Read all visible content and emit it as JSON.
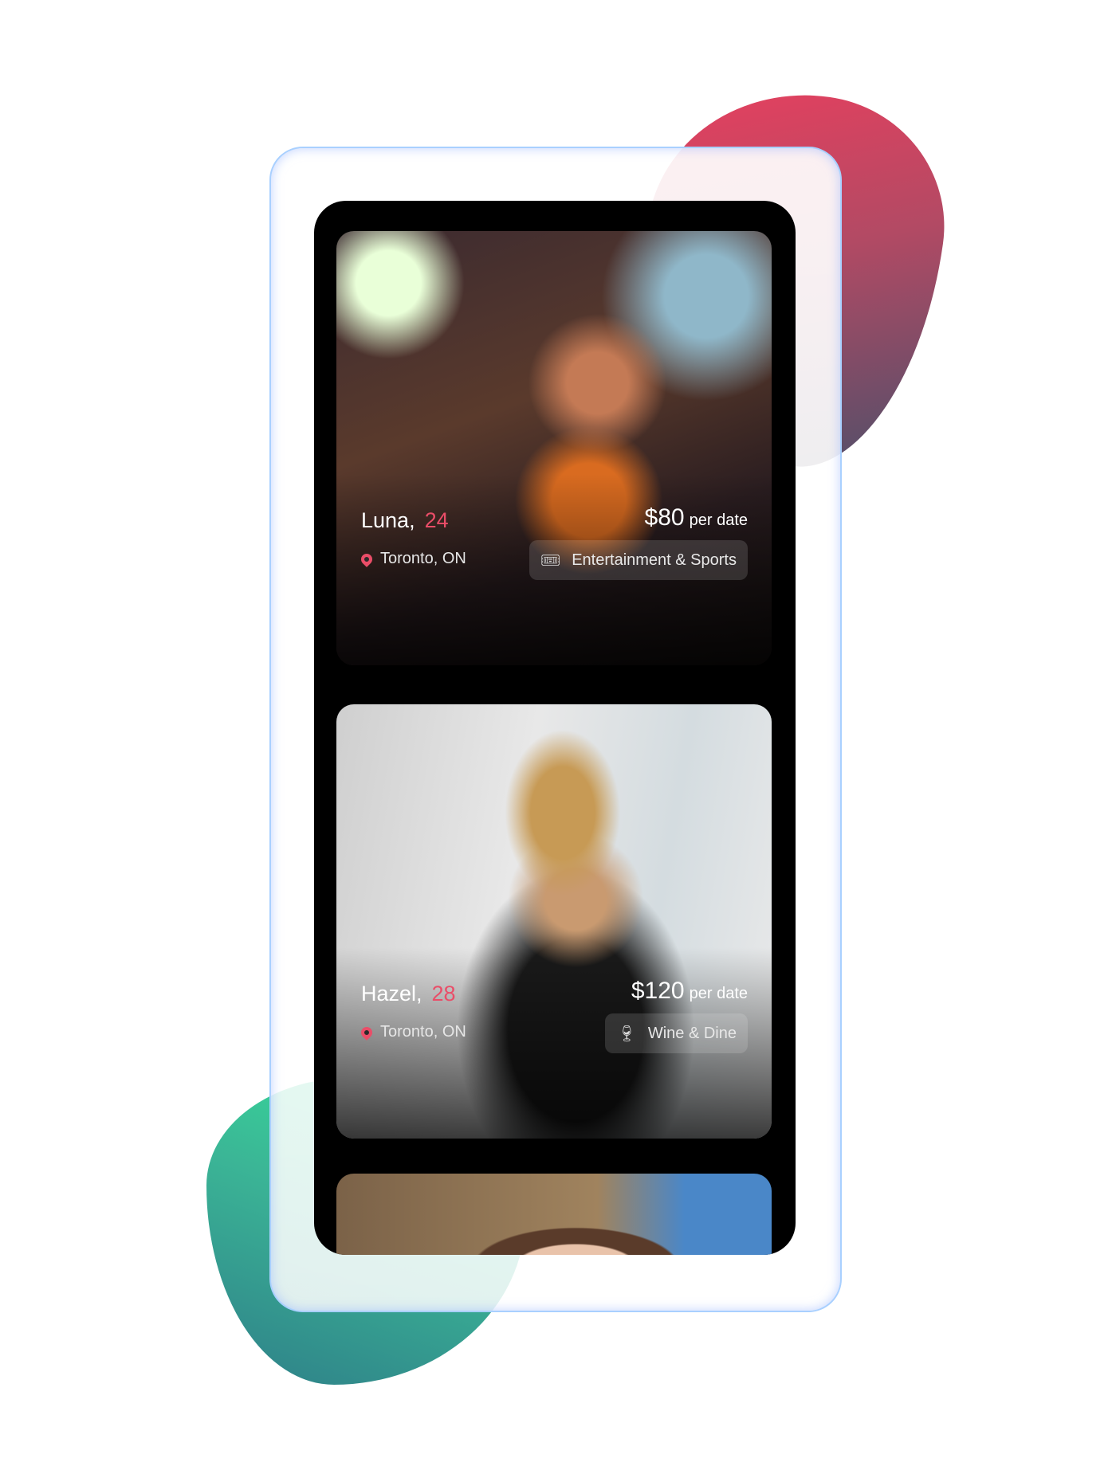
{
  "profiles": [
    {
      "name": "Luna,",
      "age": "24",
      "location": "Toronto, ON",
      "price": "$80",
      "price_unit": "per date",
      "category": "Entertainment & Sports",
      "category_icon": "ticket-icon"
    },
    {
      "name": "Hazel,",
      "age": "28",
      "location": "Toronto, ON",
      "price": "$120",
      "price_unit": "per date",
      "category": "Wine & Dine",
      "category_icon": "wine-dine-icon"
    }
  ],
  "colors": {
    "accent": "#ea4d68",
    "blob_red": "#ea3f5e",
    "blob_green": "#35e59a"
  }
}
